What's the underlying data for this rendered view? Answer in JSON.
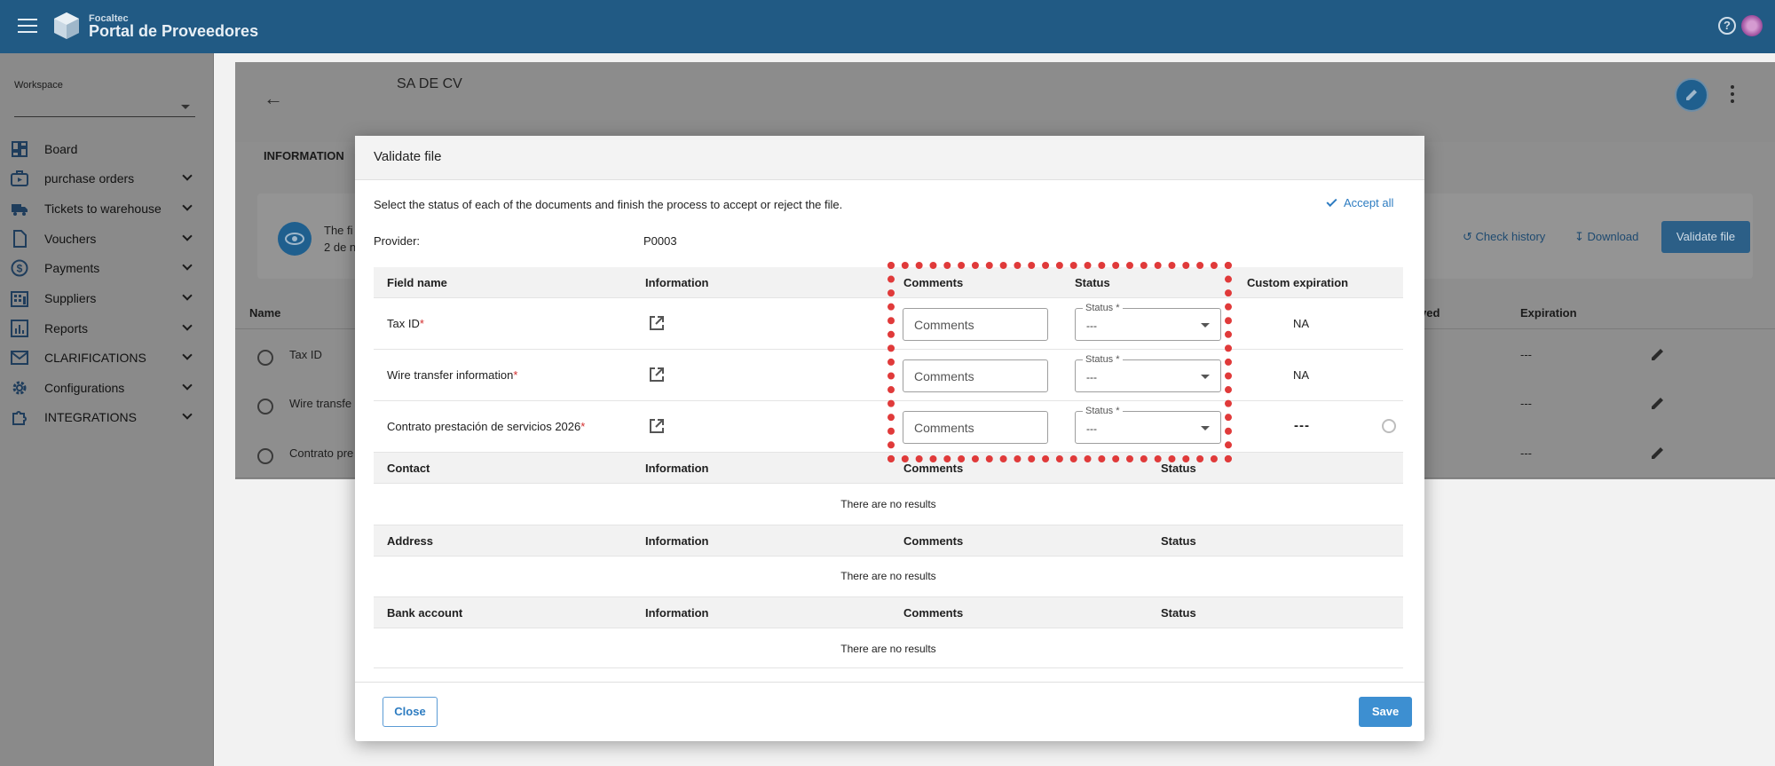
{
  "topbar": {
    "brand_small": "Focaltec",
    "brand_big": "Portal de Proveedores"
  },
  "sidebar": {
    "workspace_label": "Workspace",
    "workspace_value": "",
    "items": [
      {
        "label": "Board",
        "icon": "dashboard-icon"
      },
      {
        "label": "purchase orders",
        "icon": "purchase-order-icon"
      },
      {
        "label": "Tickets to warehouse",
        "icon": "truck-icon"
      },
      {
        "label": "Vouchers",
        "icon": "document-icon"
      },
      {
        "label": "Payments",
        "icon": "dollar-icon"
      },
      {
        "label": "Suppliers",
        "icon": "building-icon"
      },
      {
        "label": "Reports",
        "icon": "chart-icon"
      },
      {
        "label": "CLARIFICATIONS",
        "icon": "mail-icon"
      },
      {
        "label": "Configurations",
        "icon": "gear-icon"
      },
      {
        "label": "INTEGRATIONS",
        "icon": "puzzle-icon"
      }
    ]
  },
  "background": {
    "title": "SA DE CV",
    "tab": "INFORMATION",
    "card_line1": "The fi",
    "card_line2": "2 de n",
    "check_history": "Check history",
    "download": "Download",
    "validate_file": "Validate file",
    "col_name": "Name",
    "col_approved": "ved",
    "col_expiration": "Expiration",
    "rows": [
      {
        "name": "Tax ID",
        "expiration": "---"
      },
      {
        "name": "Wire transfe",
        "expiration": "---"
      },
      {
        "name": "Contrato pre",
        "expiration": "---"
      }
    ]
  },
  "modal": {
    "title": "Validate file",
    "instructions": "Select the status of each of the documents and finish the process to accept or reject the file.",
    "accept_all": "Accept all",
    "provider_label": "Provider:",
    "provider_value": "P0003",
    "files_table": {
      "headers": [
        "Field name",
        "Information",
        "Comments",
        "Status",
        "Custom expiration"
      ],
      "rows": [
        {
          "field": "Tax ID",
          "required_mark": "*",
          "comments_placeholder": "Comments",
          "status_label": "Status *",
          "status_value": "---",
          "custom_expiration": "NA"
        },
        {
          "field": "Wire transfer information",
          "required_mark": "*",
          "comments_placeholder": "Comments",
          "status_label": "Status *",
          "status_value": "---",
          "custom_expiration": "NA"
        },
        {
          "field": "Contrato prestación de servicios 2026",
          "required_mark": "*",
          "comments_placeholder": "Comments",
          "status_label": "Status *",
          "status_value": "---",
          "custom_expiration": "---"
        }
      ]
    },
    "sections": [
      {
        "title": "Contact",
        "headers": [
          "Information",
          "Comments",
          "Status"
        ],
        "empty": "There are no results"
      },
      {
        "title": "Address",
        "headers": [
          "Information",
          "Comments",
          "Status"
        ],
        "empty": "There are no results"
      },
      {
        "title": "Bank account",
        "headers": [
          "Information",
          "Comments",
          "Status"
        ],
        "empty": "There are no results"
      }
    ],
    "close_label": "Close",
    "save_label": "Save"
  },
  "colors": {
    "topbar": "#215a84",
    "accent": "#2d7cc1",
    "highlight": "#e03a3a",
    "required": "#d32f2f"
  }
}
